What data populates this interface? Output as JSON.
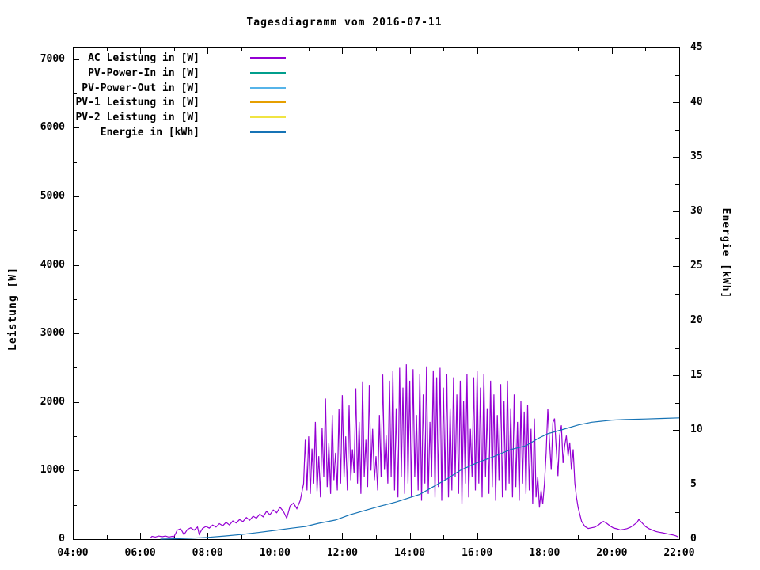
{
  "title": "Tagesdiagramm vom 2016-07-11",
  "axes": {
    "x": {
      "range": [
        4,
        22
      ],
      "major_step": 2,
      "minor_step": 1,
      "tick_labels": [
        "04:00",
        "06:00",
        "08:00",
        "10:00",
        "12:00",
        "14:00",
        "16:00",
        "18:00",
        "20:00",
        "22:00"
      ]
    },
    "y_left": {
      "label": "Leistung [W]",
      "tick_values": [
        0,
        1000,
        2000,
        3000,
        4000,
        5000,
        6000,
        7000
      ],
      "tick_labels": [
        "0",
        "1000",
        "2000",
        "3000",
        "4000",
        "5000",
        "6000",
        "7000"
      ],
      "minor_step": 500,
      "display_max": 7170
    },
    "y_right": {
      "label": "Energie [kWh]",
      "tick_values": [
        0,
        5,
        10,
        15,
        20,
        25,
        30,
        35,
        40,
        45
      ],
      "tick_labels": [
        "0",
        "5",
        "10",
        "15",
        "20",
        "25",
        "30",
        "35",
        "40",
        "45"
      ],
      "minor_step": 2.5,
      "display_max": 45
    }
  },
  "chart_data": {
    "type": "line",
    "title": "Tagesdiagramm vom 2016-07-11",
    "xlabel": "",
    "ylabel_left": "Leistung [W]",
    "ylabel_right": "Energie [kWh]",
    "xlim": [
      4,
      22
    ],
    "ylim_left": [
      0,
      7170
    ],
    "ylim_right": [
      0,
      45
    ],
    "x_unit": "hour_of_day",
    "grid": false,
    "legend_position": "inside-top-left",
    "series": [
      {
        "name": "AC Leistung in [W]",
        "color": "#9400D3",
        "axis": "left",
        "points": [
          [
            6.3,
            15
          ],
          [
            6.35,
            40
          ],
          [
            6.45,
            30
          ],
          [
            6.55,
            45
          ],
          [
            6.65,
            35
          ],
          [
            6.75,
            45
          ],
          [
            6.85,
            30
          ],
          [
            6.95,
            40
          ],
          [
            7.0,
            35
          ],
          [
            7.05,
            80
          ],
          [
            7.1,
            130
          ],
          [
            7.2,
            150
          ],
          [
            7.25,
            110
          ],
          [
            7.3,
            65
          ],
          [
            7.4,
            140
          ],
          [
            7.5,
            165
          ],
          [
            7.6,
            130
          ],
          [
            7.7,
            175
          ],
          [
            7.75,
            70
          ],
          [
            7.85,
            155
          ],
          [
            7.95,
            185
          ],
          [
            8.05,
            160
          ],
          [
            8.15,
            205
          ],
          [
            8.25,
            175
          ],
          [
            8.35,
            225
          ],
          [
            8.45,
            195
          ],
          [
            8.55,
            245
          ],
          [
            8.65,
            205
          ],
          [
            8.75,
            265
          ],
          [
            8.85,
            235
          ],
          [
            8.95,
            285
          ],
          [
            9.05,
            255
          ],
          [
            9.15,
            315
          ],
          [
            9.25,
            275
          ],
          [
            9.35,
            335
          ],
          [
            9.45,
            305
          ],
          [
            9.55,
            365
          ],
          [
            9.65,
            325
          ],
          [
            9.75,
            405
          ],
          [
            9.85,
            355
          ],
          [
            9.95,
            425
          ],
          [
            10.05,
            385
          ],
          [
            10.15,
            465
          ],
          [
            10.25,
            405
          ],
          [
            10.35,
            305
          ],
          [
            10.45,
            485
          ],
          [
            10.55,
            525
          ],
          [
            10.65,
            445
          ],
          [
            10.75,
            565
          ],
          [
            10.85,
            810
          ],
          [
            10.9,
            1450
          ],
          [
            10.95,
            710
          ],
          [
            11.0,
            1500
          ],
          [
            11.05,
            660
          ],
          [
            11.1,
            1320
          ],
          [
            11.15,
            810
          ],
          [
            11.2,
            1710
          ],
          [
            11.25,
            700
          ],
          [
            11.3,
            1210
          ],
          [
            11.35,
            610
          ],
          [
            11.4,
            1620
          ],
          [
            11.45,
            910
          ],
          [
            11.5,
            2050
          ],
          [
            11.55,
            760
          ],
          [
            11.6,
            1400
          ],
          [
            11.65,
            660
          ],
          [
            11.7,
            1810
          ],
          [
            11.75,
            860
          ],
          [
            11.8,
            1260
          ],
          [
            11.85,
            710
          ],
          [
            11.9,
            1900
          ],
          [
            11.95,
            810
          ],
          [
            12.0,
            2100
          ],
          [
            12.05,
            900
          ],
          [
            12.1,
            1500
          ],
          [
            12.15,
            710
          ],
          [
            12.2,
            1950
          ],
          [
            12.25,
            860
          ],
          [
            12.3,
            1310
          ],
          [
            12.35,
            960
          ],
          [
            12.4,
            2200
          ],
          [
            12.45,
            810
          ],
          [
            12.5,
            1710
          ],
          [
            12.55,
            660
          ],
          [
            12.6,
            2300
          ],
          [
            12.65,
            910
          ],
          [
            12.7,
            1450
          ],
          [
            12.75,
            760
          ],
          [
            12.8,
            2250
          ],
          [
            12.85,
            1000
          ],
          [
            12.9,
            1610
          ],
          [
            12.95,
            860
          ],
          [
            13.0,
            1210
          ],
          [
            13.05,
            710
          ],
          [
            13.1,
            1810
          ],
          [
            13.15,
            910
          ],
          [
            13.2,
            2400
          ],
          [
            13.25,
            1010
          ],
          [
            13.3,
            1510
          ],
          [
            13.35,
            810
          ],
          [
            13.4,
            2310
          ],
          [
            13.45,
            910
          ],
          [
            13.5,
            2450
          ],
          [
            13.55,
            710
          ],
          [
            13.6,
            1910
          ],
          [
            13.65,
            610
          ],
          [
            13.7,
            2500
          ],
          [
            13.75,
            910
          ],
          [
            13.8,
            2210
          ],
          [
            13.85,
            660
          ],
          [
            13.9,
            2550
          ],
          [
            13.95,
            810
          ],
          [
            14.0,
            2310
          ],
          [
            14.05,
            610
          ],
          [
            14.1,
            2480
          ],
          [
            14.15,
            910
          ],
          [
            14.2,
            1810
          ],
          [
            14.25,
            710
          ],
          [
            14.3,
            2410
          ],
          [
            14.35,
            560
          ],
          [
            14.4,
            2110
          ],
          [
            14.45,
            810
          ],
          [
            14.5,
            2520
          ],
          [
            14.55,
            660
          ],
          [
            14.6,
            1710
          ],
          [
            14.65,
            910
          ],
          [
            14.7,
            2460
          ],
          [
            14.75,
            610
          ],
          [
            14.8,
            2360
          ],
          [
            14.85,
            760
          ],
          [
            14.9,
            2500
          ],
          [
            14.95,
            560
          ],
          [
            15.0,
            2210
          ],
          [
            15.05,
            860
          ],
          [
            15.1,
            2410
          ],
          [
            15.15,
            610
          ],
          [
            15.2,
            1910
          ],
          [
            15.25,
            710
          ],
          [
            15.3,
            2360
          ],
          [
            15.35,
            910
          ],
          [
            15.4,
            2110
          ],
          [
            15.45,
            660
          ],
          [
            15.5,
            2310
          ],
          [
            15.55,
            510
          ],
          [
            15.6,
            2010
          ],
          [
            15.65,
            810
          ],
          [
            15.7,
            2410
          ],
          [
            15.75,
            610
          ],
          [
            15.8,
            1610
          ],
          [
            15.85,
            910
          ],
          [
            15.9,
            2360
          ],
          [
            15.95,
            710
          ],
          [
            16.0,
            2450
          ],
          [
            16.05,
            810
          ],
          [
            16.1,
            2210
          ],
          [
            16.15,
            610
          ],
          [
            16.2,
            2410
          ],
          [
            16.25,
            910
          ],
          [
            16.3,
            1910
          ],
          [
            16.35,
            660
          ],
          [
            16.4,
            2310
          ],
          [
            16.45,
            760
          ],
          [
            16.5,
            2110
          ],
          [
            16.55,
            560
          ],
          [
            16.6,
            1810
          ],
          [
            16.65,
            860
          ],
          [
            16.7,
            2260
          ],
          [
            16.75,
            610
          ],
          [
            16.8,
            2010
          ],
          [
            16.85,
            710
          ],
          [
            16.9,
            2310
          ],
          [
            16.95,
            810
          ],
          [
            17.0,
            1910
          ],
          [
            17.05,
            610
          ],
          [
            17.1,
            2110
          ],
          [
            17.15,
            760
          ],
          [
            17.2,
            1710
          ],
          [
            17.25,
            560
          ],
          [
            17.3,
            2010
          ],
          [
            17.35,
            810
          ],
          [
            17.4,
            1860
          ],
          [
            17.45,
            660
          ],
          [
            17.5,
            1960
          ],
          [
            17.55,
            710
          ],
          [
            17.6,
            1610
          ],
          [
            17.65,
            510
          ],
          [
            17.7,
            1760
          ],
          [
            17.75,
            610
          ],
          [
            17.8,
            910
          ],
          [
            17.85,
            460
          ],
          [
            17.9,
            710
          ],
          [
            17.95,
            510
          ],
          [
            18.0,
            820
          ],
          [
            18.05,
            1260
          ],
          [
            18.1,
            1900
          ],
          [
            18.15,
            1410
          ],
          [
            18.2,
            1010
          ],
          [
            18.25,
            1700
          ],
          [
            18.3,
            1760
          ],
          [
            18.35,
            1310
          ],
          [
            18.4,
            920
          ],
          [
            18.45,
            1510
          ],
          [
            18.5,
            1660
          ],
          [
            18.55,
            1110
          ],
          [
            18.6,
            1360
          ],
          [
            18.65,
            1510
          ],
          [
            18.7,
            1210
          ],
          [
            18.75,
            1410
          ],
          [
            18.8,
            1010
          ],
          [
            18.85,
            1310
          ],
          [
            18.9,
            820
          ],
          [
            18.95,
            610
          ],
          [
            19.0,
            460
          ],
          [
            19.1,
            260
          ],
          [
            19.2,
            185
          ],
          [
            19.3,
            155
          ],
          [
            19.4,
            165
          ],
          [
            19.5,
            175
          ],
          [
            19.6,
            205
          ],
          [
            19.7,
            245
          ],
          [
            19.75,
            258
          ],
          [
            19.85,
            230
          ],
          [
            19.95,
            190
          ],
          [
            20.05,
            162
          ],
          [
            20.15,
            150
          ],
          [
            20.25,
            133
          ],
          [
            20.35,
            142
          ],
          [
            20.45,
            152
          ],
          [
            20.55,
            172
          ],
          [
            20.65,
            205
          ],
          [
            20.75,
            245
          ],
          [
            20.8,
            288
          ],
          [
            20.9,
            235
          ],
          [
            21.0,
            182
          ],
          [
            21.1,
            152
          ],
          [
            21.2,
            132
          ],
          [
            21.3,
            112
          ],
          [
            21.4,
            100
          ],
          [
            21.5,
            92
          ],
          [
            21.6,
            82
          ],
          [
            21.7,
            72
          ],
          [
            21.8,
            62
          ],
          [
            21.9,
            48
          ],
          [
            21.97,
            32
          ]
        ]
      },
      {
        "name": "PV-Power-In in [W]",
        "color": "#009E8C",
        "axis": "left",
        "points": []
      },
      {
        "name": "PV-Power-Out in [W]",
        "color": "#56B4E9",
        "axis": "left",
        "points": []
      },
      {
        "name": "PV-1 Leistung in [W]",
        "color": "#E69F00",
        "axis": "left",
        "points": []
      },
      {
        "name": "PV-2 Leistung in [W]",
        "color": "#F0E442",
        "axis": "left",
        "points": []
      },
      {
        "name": "Energie in [kWh]",
        "color": "#1673B5",
        "axis": "right",
        "points": [
          [
            6.6,
            0.0
          ],
          [
            7.0,
            0.03
          ],
          [
            7.5,
            0.08
          ],
          [
            8.0,
            0.16
          ],
          [
            8.5,
            0.28
          ],
          [
            9.0,
            0.42
          ],
          [
            9.5,
            0.6
          ],
          [
            10.0,
            0.8
          ],
          [
            10.5,
            1.0
          ],
          [
            10.9,
            1.15
          ],
          [
            11.3,
            1.45
          ],
          [
            11.8,
            1.75
          ],
          [
            12.2,
            2.2
          ],
          [
            12.7,
            2.65
          ],
          [
            13.1,
            3.0
          ],
          [
            13.6,
            3.4
          ],
          [
            13.9,
            3.7
          ],
          [
            14.3,
            4.1
          ],
          [
            14.7,
            4.8
          ],
          [
            15.1,
            5.5
          ],
          [
            15.5,
            6.3
          ],
          [
            16.0,
            7.0
          ],
          [
            16.45,
            7.5
          ],
          [
            17.0,
            8.2
          ],
          [
            17.45,
            8.55
          ],
          [
            17.8,
            9.2
          ],
          [
            18.1,
            9.65
          ],
          [
            18.5,
            10.0
          ],
          [
            19.0,
            10.45
          ],
          [
            19.4,
            10.7
          ],
          [
            19.7,
            10.8
          ],
          [
            20.0,
            10.9
          ],
          [
            20.4,
            10.95
          ],
          [
            21.0,
            11.0
          ],
          [
            21.5,
            11.05
          ],
          [
            22.0,
            11.1
          ]
        ]
      }
    ]
  }
}
